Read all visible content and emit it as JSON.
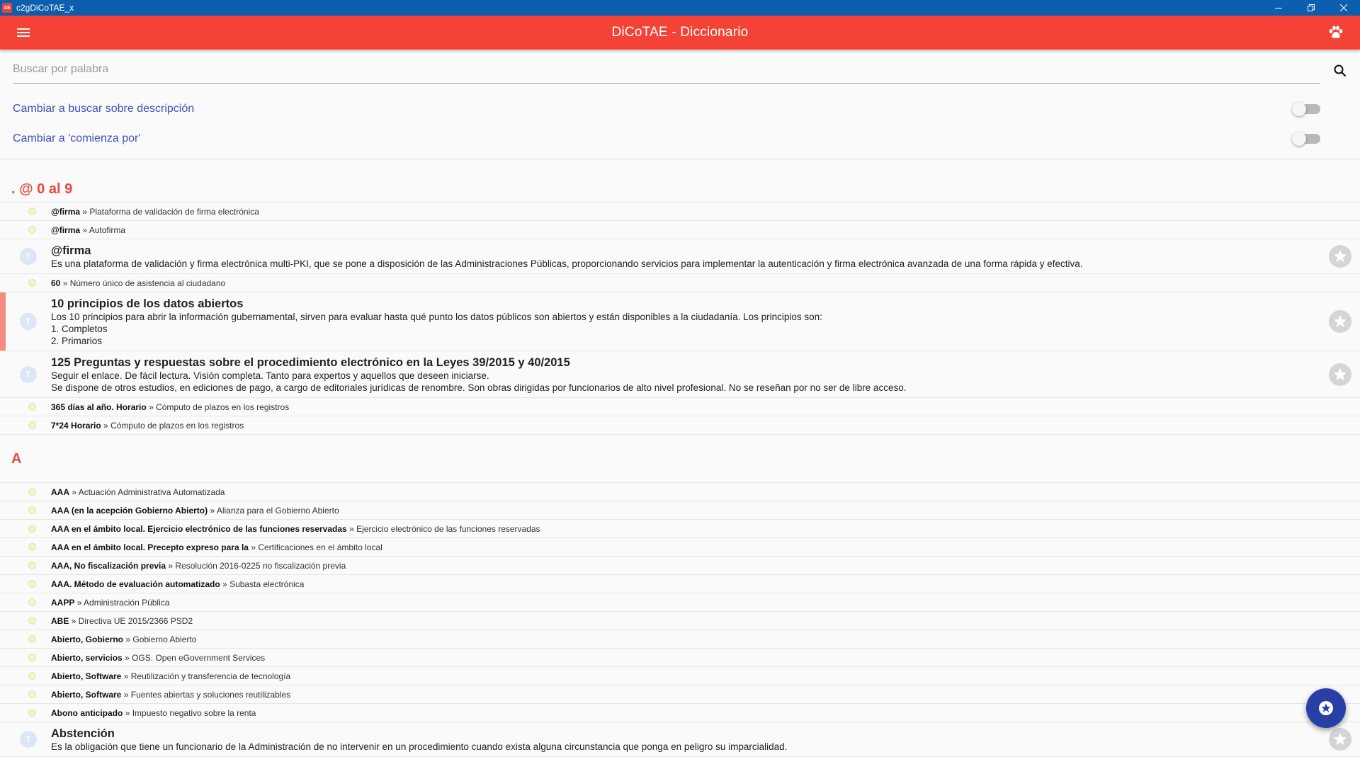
{
  "window": {
    "logo_text": "AE",
    "title": "c2gDiCoTAE_x"
  },
  "appbar": {
    "title": "DiCoTAE - Diccionario",
    "accent_color": "#f44336"
  },
  "search": {
    "placeholder": "Buscar por palabra",
    "value": ""
  },
  "options": {
    "description_label": "Cambiar a buscar sobre descripción",
    "starts_with_label": "Cambiar a 'comienza por'"
  },
  "sections": [
    {
      "header": ". @ 0 al 9",
      "items": [
        {
          "type": "ref",
          "term": "@firma",
          "target": "Plataforma de validación de firma electrónica"
        },
        {
          "type": "ref",
          "term": "@firma",
          "target": "Autofirma"
        },
        {
          "type": "entry",
          "term": "@firma",
          "avatar": "T",
          "lines": [
            "Es una plataforma de validación y firma electrónica multi-PKI, que se pone a disposición de las Administraciones Públicas, proporcionando servicios para implementar la autenticación y firma electrónica avanzada de una forma rápida y efectiva."
          ]
        },
        {
          "type": "ref",
          "term": "60",
          "target": "Número único de asistencia al ciudadano"
        },
        {
          "type": "entry",
          "term": "10 principios de los datos abiertos",
          "avatar": "T",
          "highlight": true,
          "lines": [
            "Los 10 principios para abrir la información gubernamental, sirven para evaluar hasta qué punto los datos públicos son abiertos y están disponibles a la ciudadanía. Los principios son:",
            "1. Completos",
            "2. Primarios"
          ]
        },
        {
          "type": "entry",
          "term": "125 Preguntas y respuestas sobre el procedimiento electrónico en la Leyes  39/2015 y 40/2015",
          "avatar": "T",
          "lines": [
            "Seguir el enlace. De fácil lectura. Visión completa. Tanto para expertos y aquellos que deseen iniciarse.",
            "Se dispone de otros estudios, en ediciones de pago, a cargo de editoriales jurídicas de renombre. Son obras dirigidas por funcionarios de alto nivel profesional. No se reseñan por no ser de libre acceso."
          ]
        },
        {
          "type": "ref",
          "term": "365 días al año. Horario",
          "target": "Cómputo de plazos en los registros"
        },
        {
          "type": "ref",
          "term": "7*24 Horario",
          "target": "Cómputo de plazos en los registros"
        }
      ]
    },
    {
      "header": "A",
      "items": [
        {
          "type": "ref",
          "term": "AAA",
          "target": "Actuación Administrativa Automatizada"
        },
        {
          "type": "ref",
          "term": "AAA (en la acepción Gobierno Abierto)",
          "target": "Alianza para el Gobierno Abierto"
        },
        {
          "type": "ref",
          "term": "AAA en el ámbito local. Ejercicio electrónico de las funciones reservadas",
          "target": "Ejercicio electrónico de las funciones reservadas"
        },
        {
          "type": "ref",
          "term": "AAA en el ámbito local. Precepto expreso para la",
          "target": "Certificaciones en el ámbito local"
        },
        {
          "type": "ref",
          "term": "AAA, No fiscalización previa",
          "target": "Resolución 2016-0225 no fiscalización previa"
        },
        {
          "type": "ref",
          "term": "AAA. Método de evaluación automatizado",
          "target": "Subasta electrónica"
        },
        {
          "type": "ref",
          "term": "AAPP",
          "target": "Administración Pública"
        },
        {
          "type": "ref",
          "term": "ABE",
          "target": "Directiva UE 2015/2366 PSD2"
        },
        {
          "type": "ref",
          "term": "Abierto, Gobierno",
          "target": "Gobierno Abierto"
        },
        {
          "type": "ref",
          "term": "Abierto, servicios",
          "target": "OGS. Open eGovernment Services"
        },
        {
          "type": "ref",
          "term": "Abierto, Software",
          "target": "Reutilización y transferencia de tecnología"
        },
        {
          "type": "ref",
          "term": "Abierto, Software",
          "target": "Fuentes abiertas y soluciones reutilizables"
        },
        {
          "type": "ref",
          "term": "Abono anticipado",
          "target": "Impuesto negativo sobre la renta"
        },
        {
          "type": "entry",
          "term": "Abstención",
          "avatar": "T",
          "lines": [
            "Es la obligación que tiene un funcionario de la Administración de no intervenir en un procedimiento cuando exista alguna circunstancia que ponga en peligro su imparcialidad."
          ]
        }
      ]
    }
  ],
  "ref_separator": "»"
}
